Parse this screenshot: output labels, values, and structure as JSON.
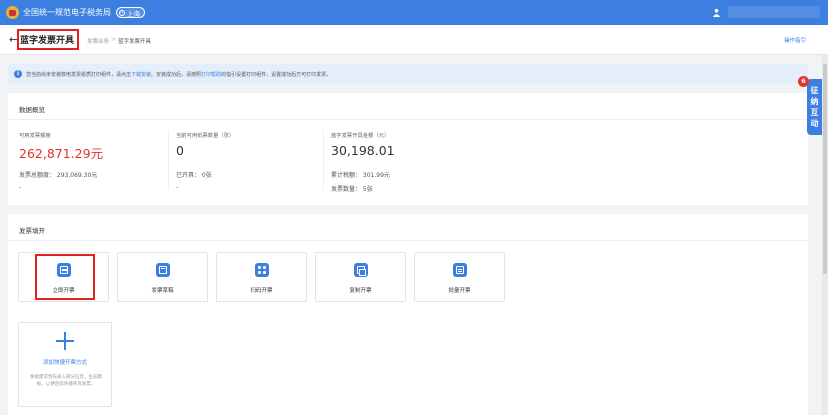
{
  "header": {
    "site_title": "全国统一规范电子税务局",
    "region": "上海"
  },
  "breadcrumb": {
    "title": "蓝字发票开具",
    "level1": "发票业务",
    "separator": ">",
    "level2": "蓝字发票开具",
    "guide_link": "操作指引"
  },
  "notice": {
    "part1": "您当前尚未安装数电发票纸质打印组件，请点击",
    "link1": "下载安装",
    "part2": "。安装成功后，请按照",
    "link2": "打印帮助",
    "part3": "的指引设置打印组件，设置成功后方可打印发票。"
  },
  "side_tab": {
    "label_chars": [
      "征",
      "纳",
      "互",
      "动"
    ],
    "badge": "6"
  },
  "overview": {
    "title": "数据概览",
    "col1": {
      "label": "可用发票额度",
      "value": "262,871.29元",
      "sub1": "发票总额度：  293,069.30元",
      "sub2": "-"
    },
    "col2": {
      "label": "当前可用纸票数量（张）",
      "value": "0",
      "sub1": "已开具：  0张",
      "sub2": "-"
    },
    "col3": {
      "label": "蓝字发票开具金额（元）",
      "value": "30,198.01",
      "sub1": "累计税额：  301.99元",
      "sub2": "发票数量：  5张"
    }
  },
  "issue": {
    "title": "发票填开",
    "tiles": [
      {
        "label": "立即开票",
        "icon": "invoice-issue-icon"
      },
      {
        "label": "发票草稿",
        "icon": "draft-icon"
      },
      {
        "label": "扫码开票",
        "icon": "qr-code-icon"
      },
      {
        "label": "复制开票",
        "icon": "copy-icon"
      },
      {
        "label": "批量开票",
        "icon": "batch-icon"
      }
    ],
    "add_tile": {
      "label": "添加快捷开票方式",
      "desc": "根据需求预先录入部分信息，生成模板，以便后续快捷开具发票。"
    }
  },
  "colors": {
    "primary": "#3d7fe0",
    "highlight_red": "#e5322d",
    "annotation_border": "#e02222"
  }
}
